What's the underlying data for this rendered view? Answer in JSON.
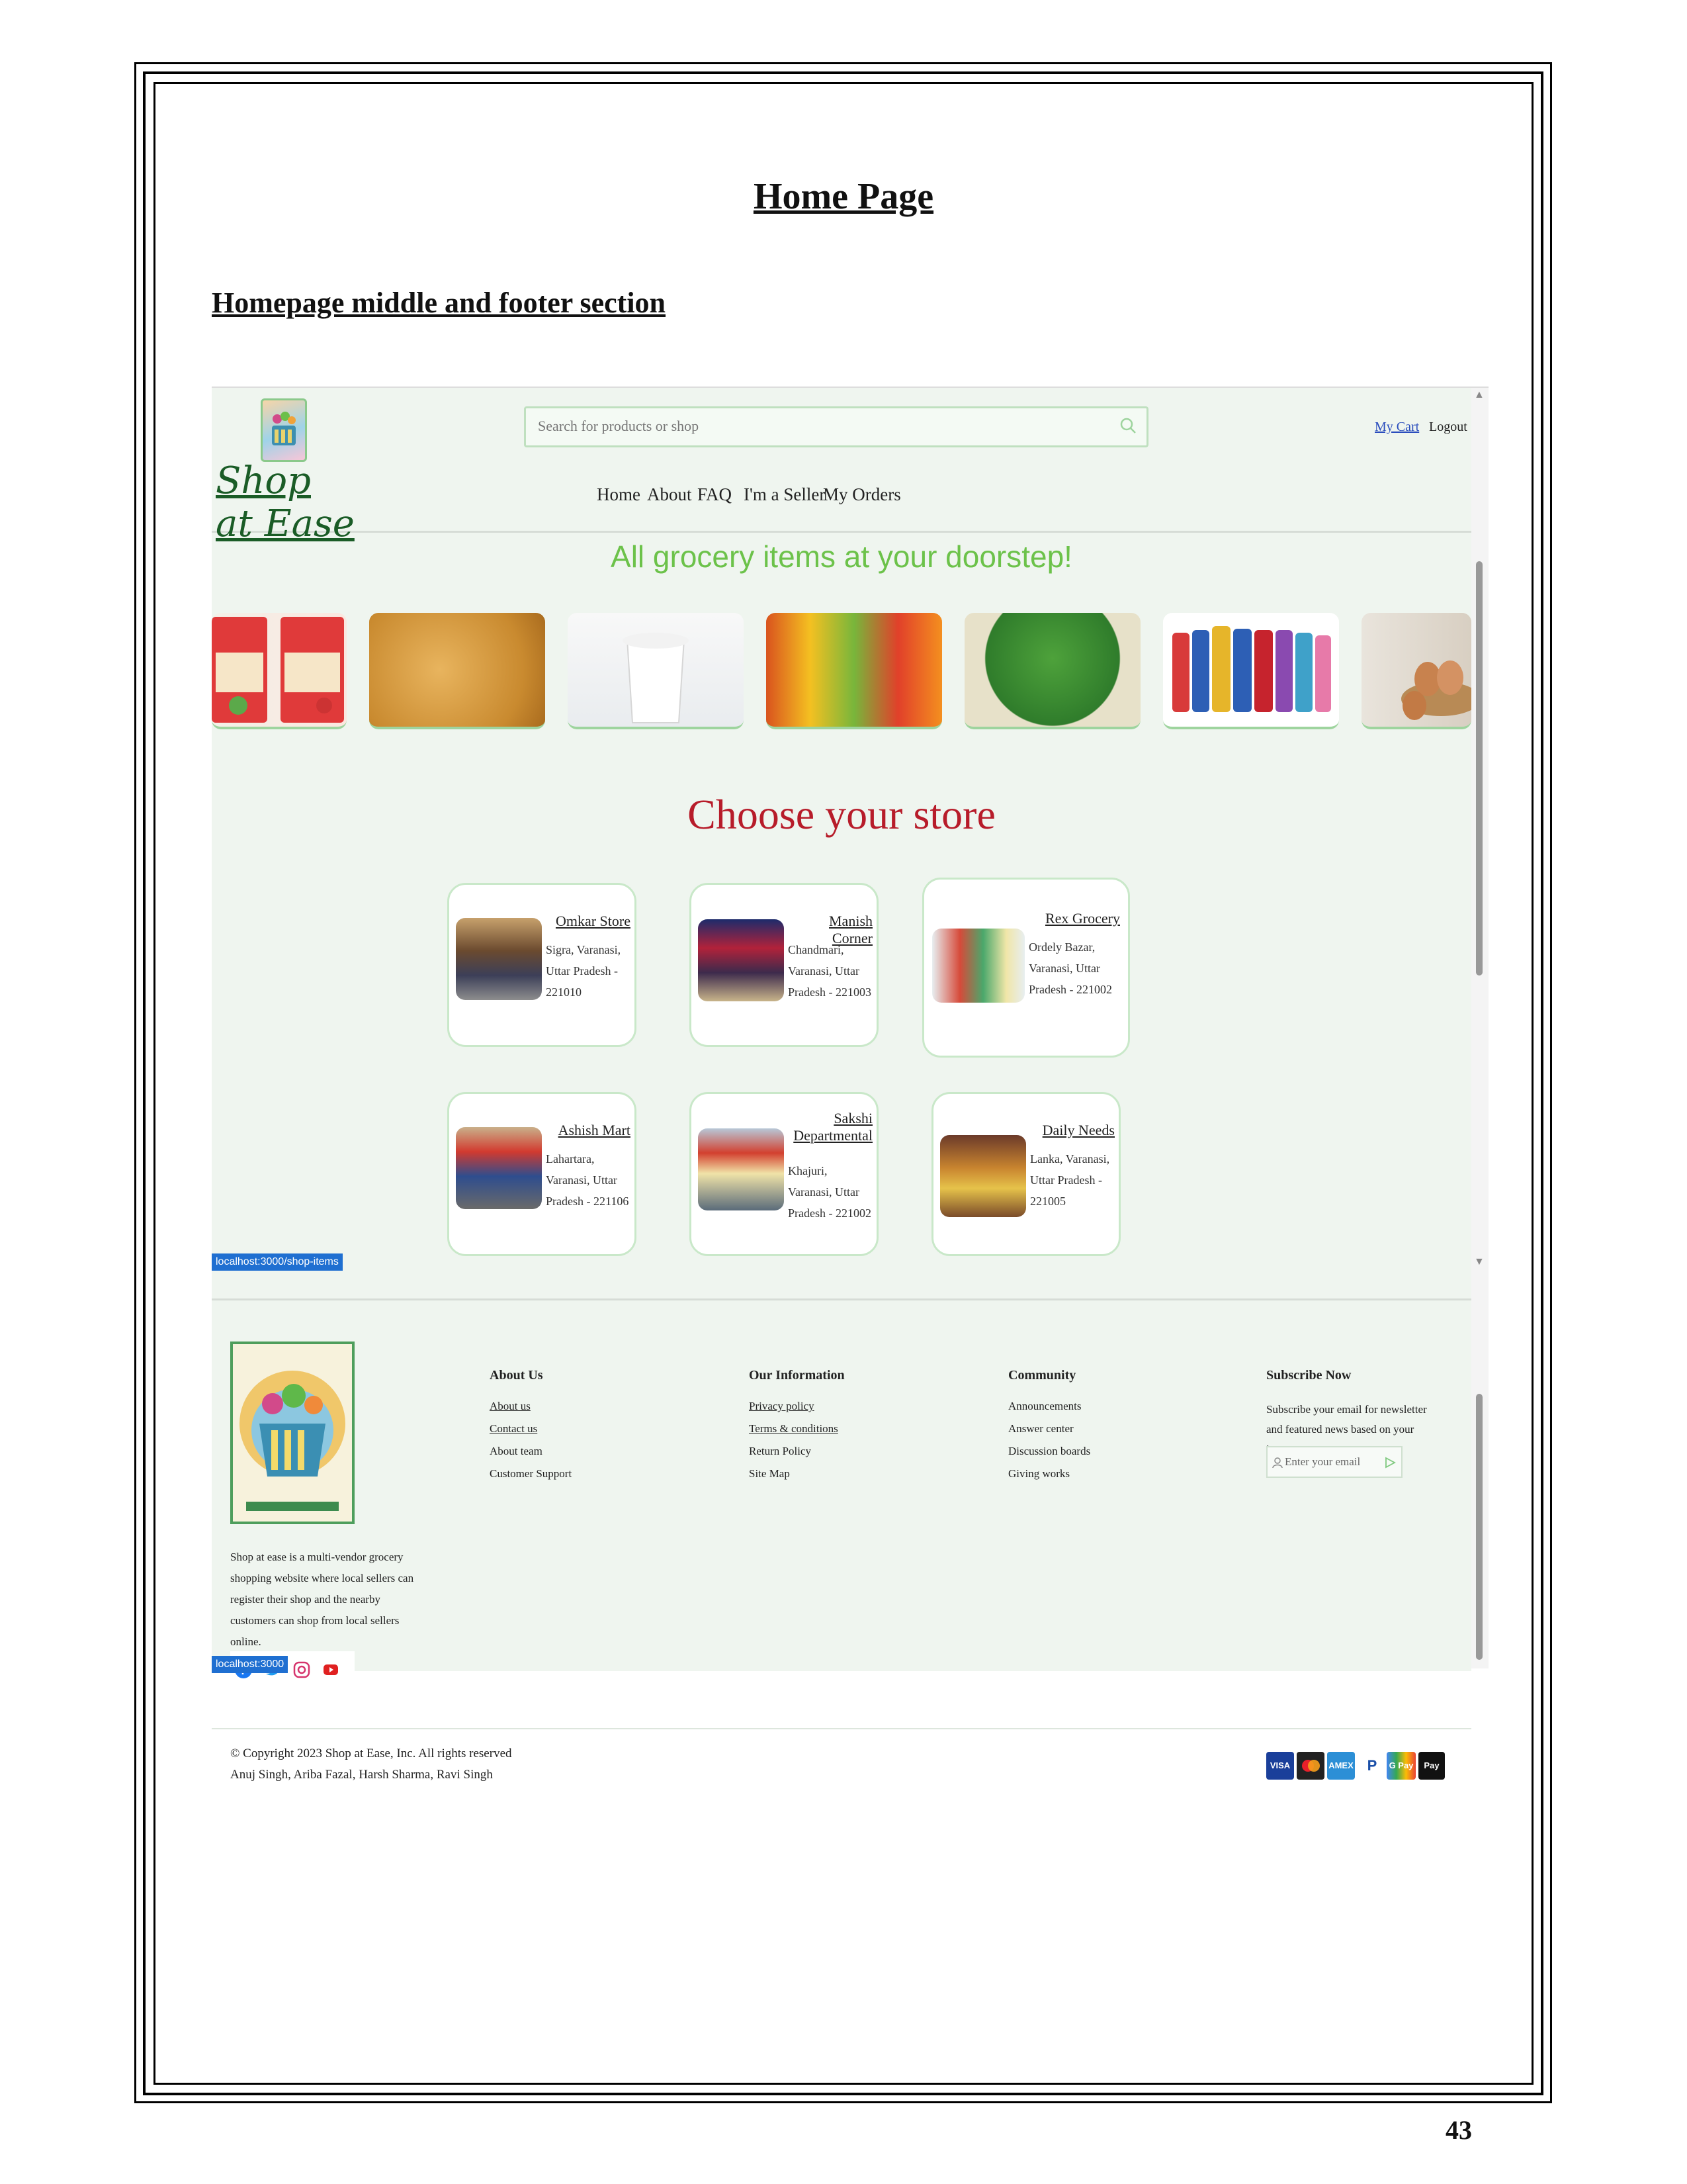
{
  "document": {
    "title": "Home Page",
    "subtitle": "Homepage middle and footer section",
    "page_number": "43"
  },
  "header": {
    "logo_text": "Shop at Ease",
    "search_placeholder": "Search for products or shop",
    "my_cart": "My Cart",
    "logout": "Logout",
    "nav": [
      "Home",
      "About",
      "FAQ",
      "I'm a Seller",
      "My Orders"
    ]
  },
  "hero": {
    "headline": "All grocery items at your doorstep!",
    "categories_icons": [
      "cerelac-image",
      "chips-image",
      "milk-image",
      "fruits-image",
      "vegetables-image",
      "horlicks-image",
      "eggs-image"
    ]
  },
  "stores": {
    "heading": "Choose your store",
    "items": [
      {
        "name": "Omkar Store",
        "address": "Sigra, Varanasi, Uttar Pradesh - 221010"
      },
      {
        "name": "Manish Corner",
        "address": "Chandmari, Varanasi, Uttar Pradesh - 221003"
      },
      {
        "name": "Rex Grocery",
        "address": "Ordely Bazar, Varanasi, Uttar Pradesh - 221002"
      },
      {
        "name": "Ashish Mart",
        "address": "Lahartara, Varanasi, Uttar Pradesh - 221106"
      },
      {
        "name": "Sakshi Departmental",
        "address": "Khajuri, Varanasi, Uttar Pradesh - 221002"
      },
      {
        "name": "Daily Needs",
        "address": "Lanka, Varanasi, Uttar Pradesh - 221005"
      }
    ]
  },
  "status_bars": {
    "shop_items": "localhost:3000/shop-items",
    "home": "localhost:3000"
  },
  "footer": {
    "description": "Shop at ease is a multi-vendor grocery shopping website where local sellers can register their shop and the nearby customers can shop from local sellers online.",
    "about": {
      "heading": "About Us",
      "links": [
        "About us",
        "Contact us",
        "About team",
        "Customer Support"
      ]
    },
    "info": {
      "heading": "Our Information",
      "links": [
        "Privacy policy",
        "Terms & conditions",
        "Return Policy",
        "Site Map"
      ]
    },
    "community": {
      "heading": "Community",
      "links": [
        "Announcements",
        "Answer center",
        "Discussion boards",
        "Giving works"
      ]
    },
    "subscribe": {
      "heading": "Subscribe Now",
      "text": "Subscribe your email for newsletter and featured news based on your interest",
      "placeholder": "Enter your email"
    },
    "copyright": "© Copyright 2023 Shop at Ease, Inc. All rights reserved",
    "authors": "Anuj Singh, Ariba Fazal, Harsh Sharma, Ravi Singh",
    "social_icons": [
      "facebook-icon",
      "twitter-icon",
      "instagram-icon",
      "youtube-icon"
    ],
    "payments": [
      "VISA",
      "AMEX",
      "P",
      "G Pay",
      "Pay"
    ]
  },
  "colors": {
    "page_bg": "#eff5ef",
    "hero_green": "#6cc24a",
    "choose_red": "#b71c2a",
    "link_blue": "#2a4dbd",
    "status_blue": "#1f6fd1"
  }
}
